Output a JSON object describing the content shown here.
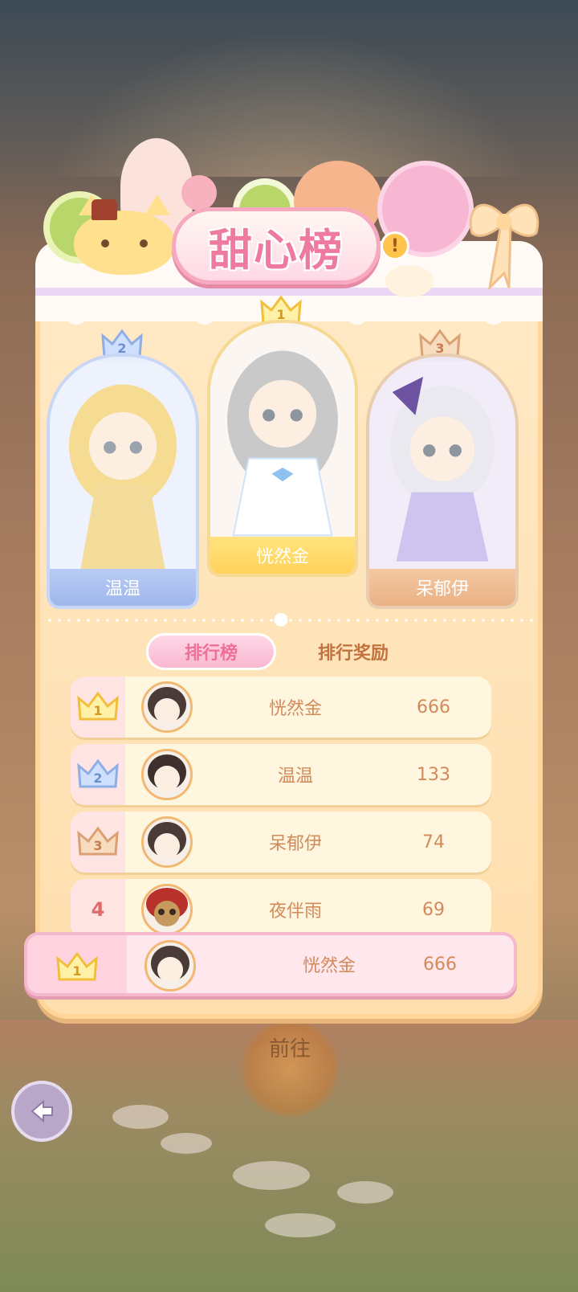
{
  "title": "甜心榜",
  "podium": [
    {
      "rank": "2",
      "name": "温温"
    },
    {
      "rank": "1",
      "name": "恍然金"
    },
    {
      "rank": "3",
      "name": "呆郁伊"
    }
  ],
  "tabs": {
    "ranking": "排行榜",
    "rewards": "排行奖励"
  },
  "ranking": [
    {
      "rank": "1",
      "name": "恍然金",
      "score": "666"
    },
    {
      "rank": "2",
      "name": "温温",
      "score": "133"
    },
    {
      "rank": "3",
      "name": "呆郁伊",
      "score": "74"
    },
    {
      "rank": "4",
      "name": "夜伴雨",
      "score": "69"
    }
  ],
  "my_rank": {
    "rank": "1",
    "name": "恍然金",
    "score": "666"
  },
  "goto_label": "前往",
  "colors": {
    "gold": "#ffd25a",
    "silver": "#9fb7ec",
    "bronze": "#e9b184",
    "pink_accent": "#ee7aa0"
  },
  "icons": {
    "back": "arrow-left-icon",
    "info": "exclamation-icon",
    "crown": "crown-icon",
    "paw": "paw-icon"
  }
}
